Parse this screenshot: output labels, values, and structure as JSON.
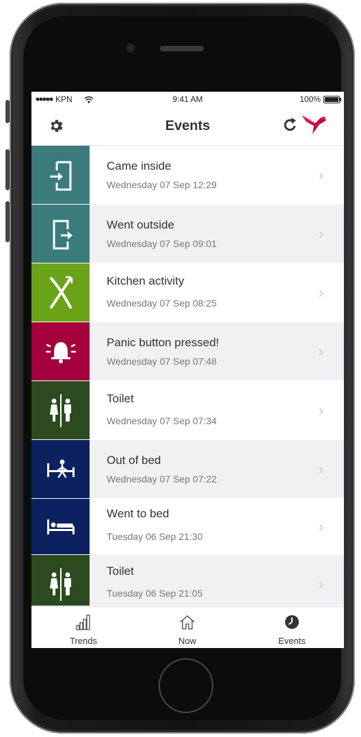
{
  "statusbar": {
    "carrier": "KPN",
    "time": "9:41 AM",
    "battery": "100%"
  },
  "header": {
    "title": "Events"
  },
  "colors": {
    "door": "#3b7b7b",
    "kitchen": "#6aa317",
    "panic": "#a4003c",
    "toilet": "#2c4a1f",
    "bed": "#0b2160",
    "logo": "#e0144c"
  },
  "events": [
    {
      "title": "Came inside",
      "time": "Wednesday 07 Sep 12:29",
      "icon": "door-enter-icon"
    },
    {
      "title": "Went outside",
      "time": "Wednesday 07 Sep 09:01",
      "icon": "door-exit-icon"
    },
    {
      "title": "Kitchen activity",
      "time": "Wednesday 07 Sep 08:25",
      "icon": "fork-knife-icon"
    },
    {
      "title": "Panic button pressed!",
      "time": "Wednesday 07 Sep 07:48",
      "icon": "alarm-bell-icon"
    },
    {
      "title": "Toilet",
      "time": "Wednesday 07 Sep 07:34",
      "icon": "toilet-icon"
    },
    {
      "title": "Out of bed",
      "time": "Wednesday 07 Sep 07:22",
      "icon": "out-of-bed-icon"
    },
    {
      "title": "Went to bed",
      "time": "Tuesday 06 Sep 21:30",
      "icon": "bed-icon"
    },
    {
      "title": "Toilet",
      "time": "Tuesday 06 Sep 21:05",
      "icon": "toilet-icon"
    }
  ],
  "tabs": [
    {
      "label": "Trends",
      "icon": "bar-chart-icon"
    },
    {
      "label": "Now",
      "icon": "home-icon"
    },
    {
      "label": "Events",
      "icon": "clock-icon"
    }
  ]
}
